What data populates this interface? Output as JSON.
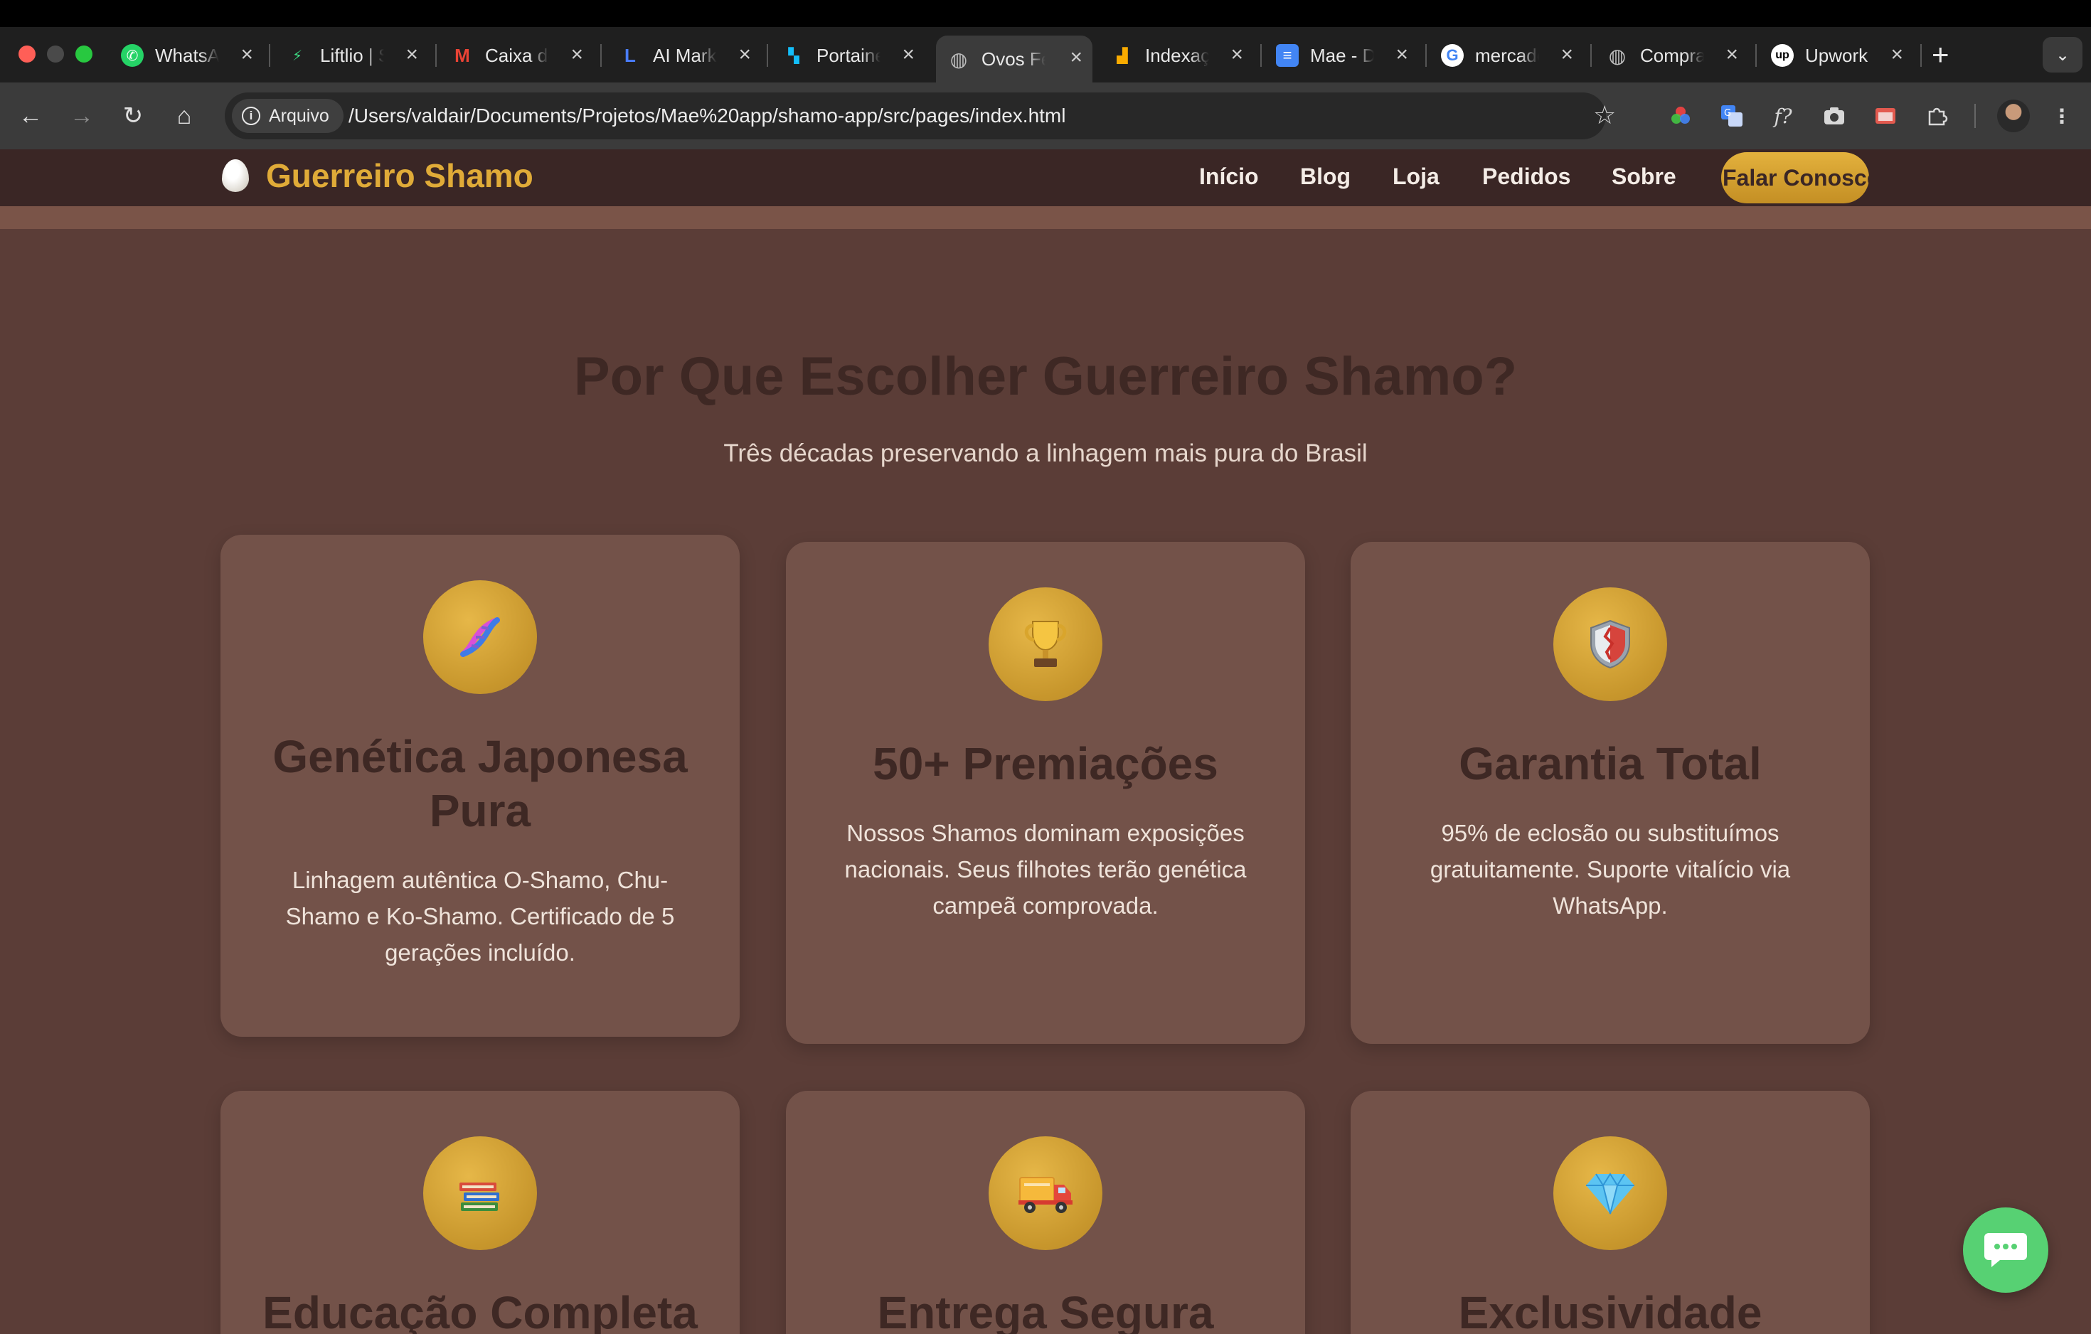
{
  "browser": {
    "tabs": [
      {
        "label": "WhatsApp",
        "icon": "whatsapp-icon",
        "active": false
      },
      {
        "label": "Liftlio | S",
        "icon": "liftlio-icon",
        "active": false
      },
      {
        "label": "Caixa de",
        "icon": "gmail-icon",
        "active": false
      },
      {
        "label": "AI Market",
        "icon": "app-icon",
        "active": false
      },
      {
        "label": "Portainer",
        "icon": "portainer-icon",
        "active": false
      },
      {
        "label": "Ovos Fé",
        "icon": "globe-icon",
        "active": true
      },
      {
        "label": "Indexação",
        "icon": "analytics-icon",
        "active": false
      },
      {
        "label": "Mae - D",
        "icon": "docs-icon",
        "active": false
      },
      {
        "label": "mercado",
        "icon": "google-icon",
        "active": false
      },
      {
        "label": "Compra",
        "icon": "globe-icon",
        "active": false
      },
      {
        "label": "Upwork",
        "icon": "upwork-icon",
        "active": false
      }
    ],
    "security_chip": "Arquivo",
    "url": "/Users/valdair/Documents/Projetos/Mae%20app/shamo-app/src/pages/index.html"
  },
  "site": {
    "logo_text": "Guerreiro Shamo",
    "nav": [
      "Início",
      "Blog",
      "Loja",
      "Pedidos",
      "Sobre"
    ],
    "cta": "Falar Conosco"
  },
  "section": {
    "title": "Por Que Escolher Guerreiro Shamo?",
    "subtitle": "Três décadas preservando a linhagem mais pura do Brasil"
  },
  "features": [
    {
      "icon": "🧬",
      "icon_name": "dna-icon",
      "title": "Genética Japonesa Pura",
      "text": "Linhagem autêntica O-Shamo, Chu-Shamo e Ko-Shamo. Certificado de 5 gerações incluído."
    },
    {
      "icon": "🏆",
      "icon_name": "trophy-icon",
      "title": "50+ Premiações",
      "text": "Nossos Shamos dominam exposições nacionais. Seus filhotes terão genética campeã comprovada."
    },
    {
      "icon": "🛡️",
      "icon_name": "shield-icon",
      "title": "Garantia Total",
      "text": "95% de eclosão ou substituímos gratuitamente. Suporte vitalício via WhatsApp."
    },
    {
      "icon": "📚",
      "icon_name": "books-icon",
      "title": "Educação Completa",
      "text": ""
    },
    {
      "icon": "🚚",
      "icon_name": "delivery-truck-icon",
      "title": "Entrega Segura",
      "text": ""
    },
    {
      "icon": "💎",
      "icon_name": "diamond-icon",
      "title": "Exclusividade",
      "text": ""
    }
  ],
  "colors": {
    "page_bg": "#5b3d37",
    "header_bg": "#3a2625",
    "accent_gold": "#e0ab38",
    "card_bg": "#735249",
    "whatsapp_green": "#57d173"
  }
}
